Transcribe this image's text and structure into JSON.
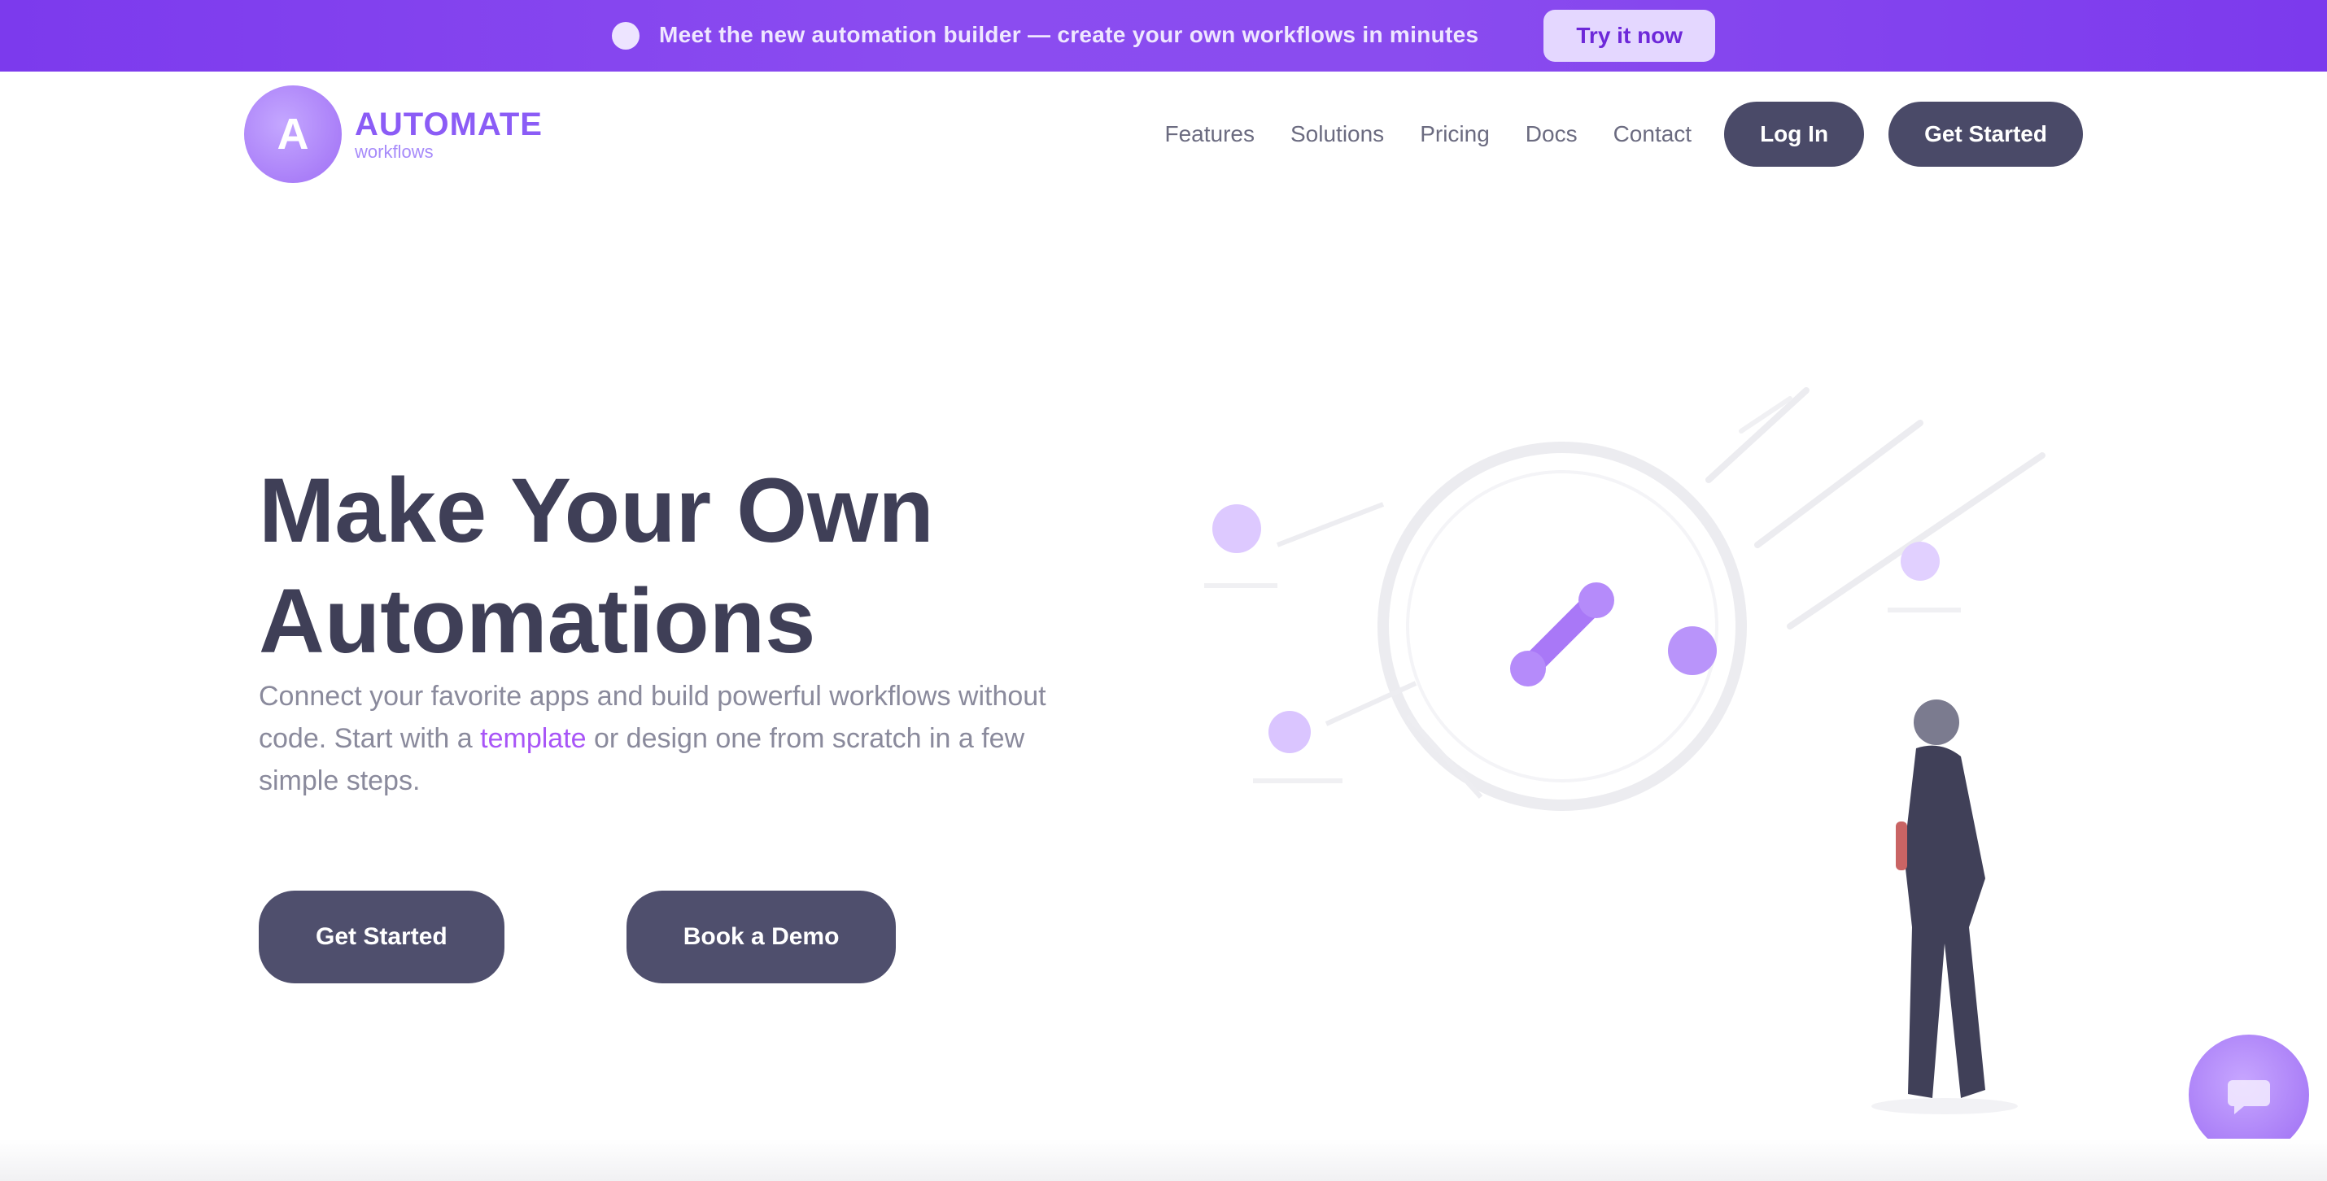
{
  "topbar": {
    "announcement": "Meet the new automation builder — create your own workflows in minutes",
    "cta_label": "Try it now"
  },
  "nav": {
    "logo_initial": "A",
    "logo_name": "AUTOMATE",
    "logo_tagline": "workflows",
    "links": [
      "Features",
      "Solutions",
      "Pricing",
      "Docs",
      "Contact"
    ],
    "login_label": "Log In",
    "signup_label": "Get Started"
  },
  "hero": {
    "title_line1": "Make Your Own",
    "title_line2": "Automations",
    "subtitle_part1": "Connect your favorite apps and build powerful workflows without code. Start with a",
    "subtitle_accent": "template",
    "subtitle_part2": "or design one from scratch in a few simple steps.",
    "primary_button": "Get Started",
    "secondary_button": "Book a Demo"
  },
  "colors": {
    "brand": "#7c3aed",
    "accent": "#a855f7",
    "dark_button": "#4a4a68"
  },
  "icons": {
    "chat": "chat-bubble-icon"
  }
}
